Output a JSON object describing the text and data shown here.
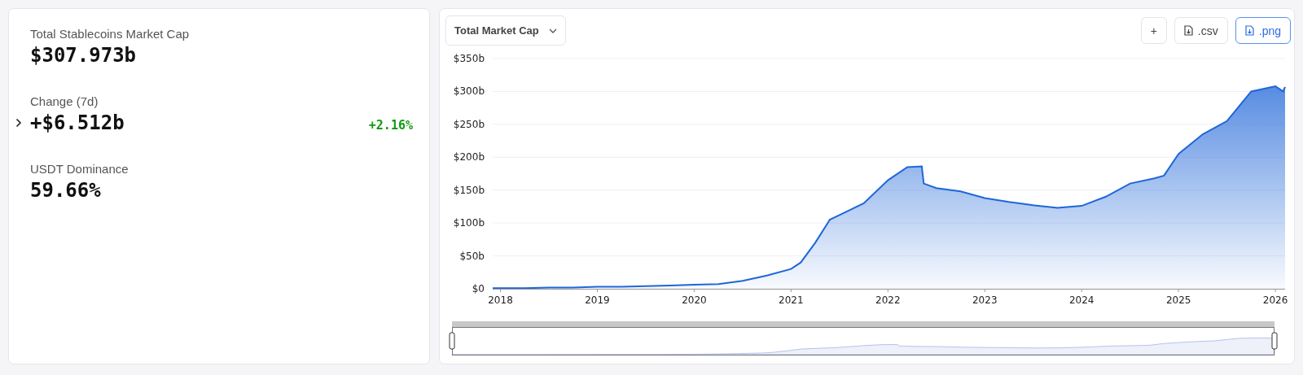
{
  "summary": {
    "stats": [
      {
        "label": "Total Stablecoins Market Cap",
        "value": "$307.973b",
        "expandable": false
      },
      {
        "label": "Change (7d)",
        "value": "+$6.512b",
        "expandable": true,
        "change": "+2.16%",
        "positive": true
      },
      {
        "label": "USDT Dominance",
        "value": "59.66%",
        "expandable": false
      }
    ]
  },
  "chart_panel": {
    "metric_select": {
      "value": "Total Market Cap"
    },
    "buttons": [
      {
        "label": "+",
        "kind": "icon",
        "primary": false
      },
      {
        "label": ".csv",
        "kind": "file",
        "primary": false
      },
      {
        "label": ".png",
        "kind": "file",
        "primary": true
      }
    ],
    "chart_data": {
      "type": "area",
      "grid": true,
      "xlim": [
        2017.92,
        2026.1
      ],
      "ylim": [
        0,
        350
      ],
      "yticks": [
        {
          "value": 0,
          "label": "$0"
        },
        {
          "value": 50,
          "label": "$50b"
        },
        {
          "value": 100,
          "label": "$100b"
        },
        {
          "value": 150,
          "label": "$150b"
        },
        {
          "value": 200,
          "label": "$200b"
        },
        {
          "value": 250,
          "label": "$250b"
        },
        {
          "value": 300,
          "label": "$300b"
        },
        {
          "value": 350,
          "label": "$350b"
        }
      ],
      "xticks": [
        {
          "value": 2018,
          "label": "2018"
        },
        {
          "value": 2019,
          "label": "2019"
        },
        {
          "value": 2020,
          "label": "2020"
        },
        {
          "value": 2021,
          "label": "2021"
        },
        {
          "value": 2022,
          "label": "2022"
        },
        {
          "value": 2023,
          "label": "2023"
        },
        {
          "value": 2024,
          "label": "2024"
        },
        {
          "value": 2025,
          "label": "2025"
        },
        {
          "value": 2026,
          "label": "2026"
        }
      ],
      "x": [
        2017.92,
        2018.25,
        2018.5,
        2018.75,
        2019,
        2019.25,
        2019.5,
        2019.75,
        2020,
        2020.25,
        2020.5,
        2020.75,
        2021,
        2021.1,
        2021.25,
        2021.4,
        2021.5,
        2021.75,
        2022,
        2022.2,
        2022.35,
        2022.37,
        2022.5,
        2022.75,
        2023,
        2023.25,
        2023.5,
        2023.75,
        2024,
        2024.25,
        2024.5,
        2024.75,
        2024.85,
        2025,
        2025.25,
        2025.5,
        2025.75,
        2026,
        2026.08,
        2026.1
      ],
      "series": [
        {
          "color": "#1f66d8",
          "values": [
            1,
            1,
            2,
            2,
            3,
            3,
            4,
            5,
            6,
            7,
            12,
            20,
            30,
            40,
            70,
            105,
            112,
            130,
            165,
            185,
            186,
            160,
            153,
            148,
            138,
            132,
            127,
            123,
            126,
            140,
            160,
            168,
            172,
            205,
            235,
            255,
            300,
            308,
            300,
            307
          ]
        }
      ]
    }
  }
}
